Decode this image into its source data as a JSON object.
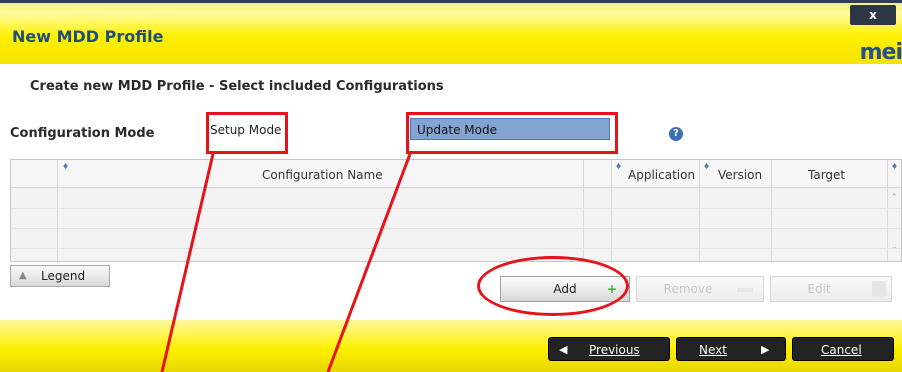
{
  "window": {
    "title": "New MDD Profile",
    "close_label": "x",
    "logo": "mei"
  },
  "subtitle": "Create new MDD Profile - Select included Configurations",
  "mode": {
    "label": "Configuration Mode",
    "setup": "Setup Mode",
    "update": "Update Mode"
  },
  "table": {
    "columns": [
      "Configuration Name",
      "Application",
      "Version",
      "Target"
    ]
  },
  "buttons": {
    "legend": "Legend",
    "add": "Add",
    "add_icon": "+",
    "remove": "Remove",
    "edit": "Edit",
    "previous": "Previous",
    "next": "Next",
    "cancel": "Cancel"
  },
  "icons": {
    "close": "close-icon",
    "help": "help-icon",
    "add": "plus-icon",
    "remove": "minus-icon",
    "edit": "edit-icon",
    "previous": "arrow-left-icon",
    "next": "arrow-right-icon",
    "legend": "triangle-icon"
  },
  "colors": {
    "title_bar": "#fff000",
    "title_text": "#1f4f7a",
    "selected_mode": "#83a3d3",
    "annotation": "#e8121a",
    "add_plus": "#3caf2d"
  }
}
